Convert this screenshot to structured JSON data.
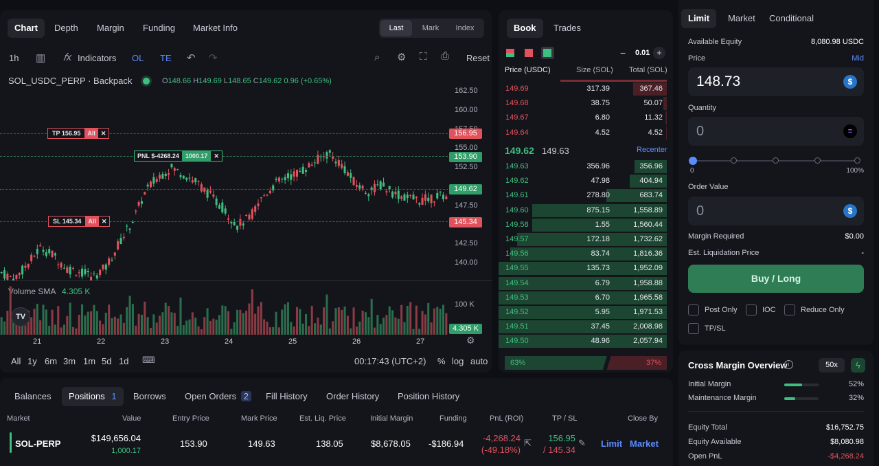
{
  "chart_tabs": [
    "Chart",
    "Depth",
    "Margin",
    "Funding",
    "Market Info"
  ],
  "price_mode": {
    "options": [
      "Last",
      "Mark",
      "Index"
    ],
    "active": "Last"
  },
  "toolbar": {
    "interval": "1h",
    "indicators": "Indicators",
    "ol": "OL",
    "te": "TE",
    "reset": "Reset"
  },
  "symbol": {
    "name": "SOL_USDC_PERP · Backpack",
    "o": "148.66",
    "h": "149.69",
    "l": "148.65",
    "c": "149.62",
    "change": "0.96 (+0.65%)"
  },
  "orders": {
    "tp": {
      "label": "TP 156.95",
      "all": "All",
      "price": "156.95"
    },
    "pnl": {
      "label": "PNL $-4268.24",
      "qty": "1000.17",
      "price": "153.90"
    },
    "sl": {
      "label": "SL 145.34",
      "all": "All",
      "price": "145.34"
    },
    "last": "149.62"
  },
  "price_axis": [
    "162.50",
    "160.00",
    "157.50",
    "155.00",
    "152.50",
    "147.50",
    "142.50",
    "140.00"
  ],
  "volume": {
    "label": "Volume SMA",
    "value": "4.305 K",
    "axis": "100 K",
    "last": "4.305 K"
  },
  "time_axis": [
    "21",
    "22",
    "23",
    "24",
    "25",
    "26",
    "27"
  ],
  "ranges": [
    "All",
    "1y",
    "6m",
    "3m",
    "1m",
    "5d",
    "1d"
  ],
  "footer": {
    "time": "00:17:43 (UTC+2)",
    "pct": "%",
    "log": "log",
    "auto": "auto"
  },
  "book": {
    "tabs": [
      "Book",
      "Trades"
    ],
    "tick": "0.01",
    "headers": [
      "Price (USDC)",
      "Size (SOL)",
      "Total (SOL)"
    ],
    "asks": [
      {
        "price": "149.69",
        "size": "317.39",
        "total": "367.46",
        "depth": 0.2
      },
      {
        "price": "149.68",
        "size": "38.75",
        "total": "50.07",
        "depth": 0.02
      },
      {
        "price": "149.67",
        "size": "6.80",
        "total": "11.32",
        "depth": 0.01
      },
      {
        "price": "149.64",
        "size": "4.52",
        "total": "4.52",
        "depth": 0.005
      }
    ],
    "mid": {
      "last": "149.62",
      "mark": "149.63",
      "recenter": "Recenter"
    },
    "bids": [
      {
        "price": "149.63",
        "size": "356.96",
        "total": "356.96",
        "depth": 0.19
      },
      {
        "price": "149.62",
        "size": "47.98",
        "total": "404.94",
        "depth": 0.22
      },
      {
        "price": "149.61",
        "size": "278.80",
        "total": "683.74",
        "depth": 0.36
      },
      {
        "price": "149.60",
        "size": "875.15",
        "total": "1,558.89",
        "depth": 0.8
      },
      {
        "price": "149.58",
        "size": "1.55",
        "total": "1,560.44",
        "depth": 0.8
      },
      {
        "price": "149.57",
        "size": "172.18",
        "total": "1,732.62",
        "depth": 0.89
      },
      {
        "price": "149.56",
        "size": "83.74",
        "total": "1,816.36",
        "depth": 0.93
      },
      {
        "price": "149.55",
        "size": "135.73",
        "total": "1,952.09",
        "depth": 1.0
      },
      {
        "price": "149.54",
        "size": "6.79",
        "total": "1,958.88",
        "depth": 1.0
      },
      {
        "price": "149.53",
        "size": "6.70",
        "total": "1,965.58",
        "depth": 1.0
      },
      {
        "price": "149.52",
        "size": "5.95",
        "total": "1,971.53",
        "depth": 1.0
      },
      {
        "price": "149.51",
        "size": "37.45",
        "total": "2,008.98",
        "depth": 1.0
      },
      {
        "price": "149.50",
        "size": "48.96",
        "total": "2,057.94",
        "depth": 1.0
      }
    ],
    "ratio": {
      "buy": "63%",
      "sell": "37%",
      "buy_frac": 0.63
    }
  },
  "order_form": {
    "tabs": [
      "Limit",
      "Market",
      "Conditional"
    ],
    "available_label": "Available Equity",
    "available_value": "8,080.98 USDC",
    "price_label": "Price",
    "mid": "Mid",
    "price_value": "148.73",
    "qty_label": "Quantity",
    "qty_value": "0",
    "slider_min": "0",
    "slider_max": "100%",
    "slider_level": 0,
    "order_value_label": "Order Value",
    "order_value": "0",
    "margin_req_label": "Margin Required",
    "margin_req": "$0.00",
    "liq_label": "Est. Liquidation Price",
    "liq_value": "-",
    "buy_button": "Buy / Long",
    "options": [
      "Post Only",
      "IOC",
      "Reduce Only",
      "TP/SL"
    ]
  },
  "margin_overview": {
    "title": "Cross Margin Overview",
    "leverage": "50x",
    "initial_label": "Initial Margin",
    "initial_pct": "52%",
    "initial_frac": 0.52,
    "maint_label": "Maintenance Margin",
    "maint_pct": "32%",
    "maint_frac": 0.32,
    "equity_total_label": "Equity Total",
    "equity_total": "$16,752.75",
    "equity_avail_label": "Equity Available",
    "equity_avail": "$8,080.98",
    "open_pnl_label": "Open PnL",
    "open_pnl": "-$4,268.24"
  },
  "bottom": {
    "tabs": [
      "Balances",
      "Positions",
      "Borrows",
      "Open Orders",
      "Fill History",
      "Order History",
      "Position History"
    ],
    "positions_count": "1",
    "open_orders_count": "2",
    "columns": [
      "Market",
      "Value",
      "Entry Price",
      "Mark Price",
      "Est. Liq. Price",
      "Initial Margin",
      "Funding",
      "PnL (ROI)",
      "TP / SL",
      "Close By"
    ],
    "row": {
      "market": "SOL-PERP",
      "value": "$149,656.04",
      "qty": "1,000.17",
      "entry": "153.90",
      "mark": "149.63",
      "liq": "138.05",
      "initial_margin": "$8,678.05",
      "funding": "-$186.94",
      "pnl": "-4,268.24",
      "roi": "(-49.18%)",
      "tp": "156.95",
      "sl": "/ 145.34",
      "limit": "Limit",
      "market_btn": "Market"
    }
  },
  "colors": {
    "green": "#3fbf7f",
    "red": "#e2525c",
    "blue": "#5b8cff",
    "buy": "#2f7d55"
  }
}
